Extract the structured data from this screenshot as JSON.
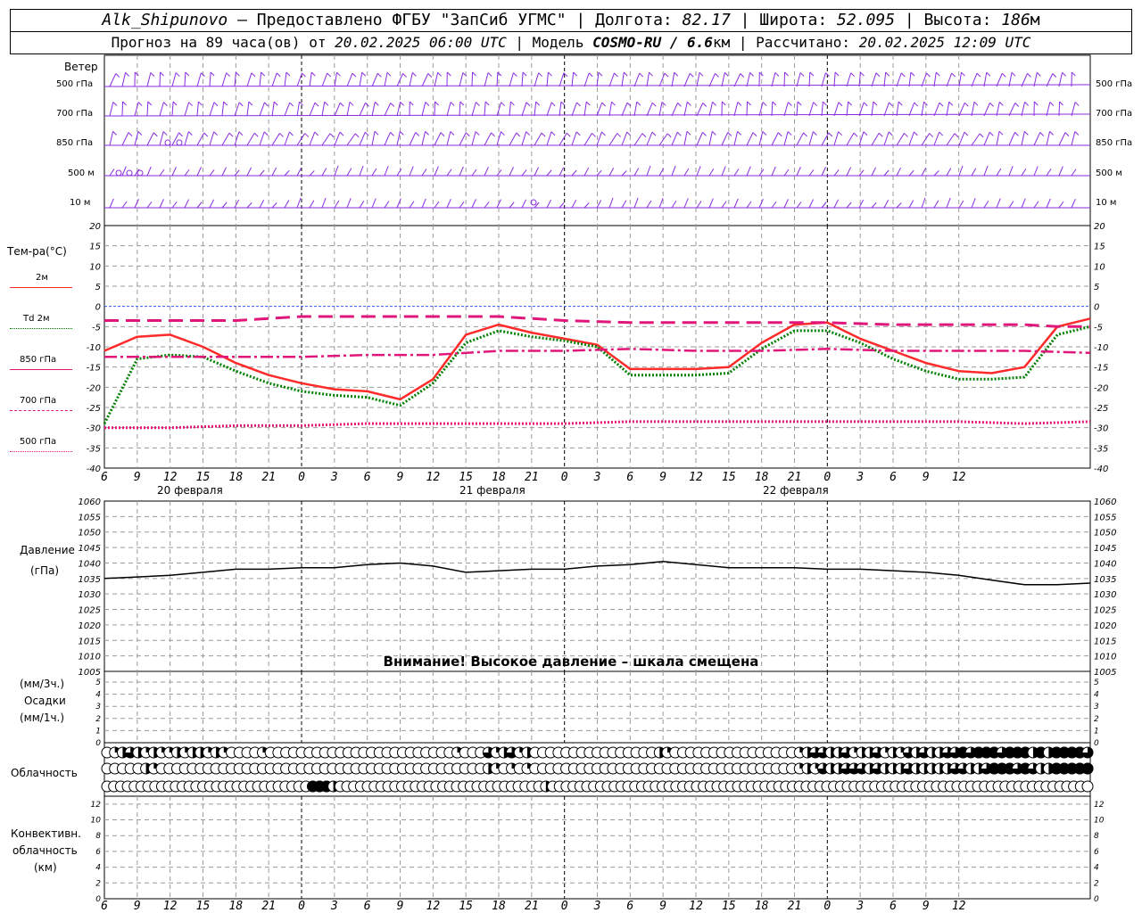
{
  "header": {
    "station": "Alk_Shipunovo",
    "provider_sep": " – Предоставлено ФГБУ \"ЗапСиб УГМС\" | ",
    "lon_label": "Долгота: ",
    "lon_value": "82.17",
    "lat_label": " | Широта: ",
    "lat_value": "52.095",
    "alt_label": " | Высота: ",
    "alt_value": "186",
    "alt_unit": "м",
    "forecast_prefix": "Прогноз на 89 часа(ов) от ",
    "forecast_date": "20.02.2025 06:00 UTC",
    "model_label": "  | Модель ",
    "model_name": "COSMO-RU / 6.6",
    "model_unit": "км",
    "calc_label": " | Рассчитано: ",
    "calc_date": "20.02.2025 12:09 UTC"
  },
  "wind_panel": {
    "title": "Ветер",
    "levels": [
      "500 гПа",
      "700 гПа",
      "850 гПа",
      "500 м",
      "10  м"
    ]
  },
  "temp_panel": {
    "title": "Тем-ра(°С)",
    "legend": [
      {
        "label": "2м",
        "color": "#ff2a2a",
        "style": "solid"
      },
      {
        "label": "Td  2м",
        "color": "#008000",
        "style": "dotted"
      },
      {
        "label": "850 гПа",
        "color": "#e0167a",
        "style": "dashdot"
      },
      {
        "label": "700 гПа",
        "color": "#e0167a",
        "style": "dashed"
      },
      {
        "label": "500 гПа",
        "color": "#e0167a",
        "style": "dotted"
      }
    ]
  },
  "time_axis": {
    "hours": [
      "6",
      "9",
      "12",
      "15",
      "18",
      "21",
      "0",
      "3",
      "6",
      "9",
      "12",
      "15",
      "18",
      "21",
      "0",
      "3",
      "6",
      "9",
      "12",
      "15",
      "18",
      "21",
      "0",
      "3",
      "6",
      "9",
      "12"
    ],
    "dates": [
      "20 февраля",
      "21 февраля",
      "22 февраля"
    ]
  },
  "pressure_panel": {
    "title": "Давление",
    "unit": "(гПа)",
    "warning": "Внимание! Высокое давление – шкала смещена"
  },
  "precip_panel": {
    "unit3": "(мм/3ч.)",
    "title": "Осадки",
    "unit1": "(мм/1ч.)"
  },
  "cloud_panel": {
    "title": "Облачность"
  },
  "conv_panel": {
    "title1": "Конвективн.",
    "title2": "облачность",
    "unit": "(км)"
  },
  "chart_data": [
    {
      "type": "line",
      "title": "Тем-ра(°С)",
      "x_unit": "hours since 20.02.2025 06:00 UTC",
      "ylim": [
        -40,
        20
      ],
      "yticks": [
        20,
        15,
        10,
        5,
        0,
        -5,
        -10,
        -15,
        -20,
        -25,
        -30,
        -35,
        -40
      ],
      "grid": true,
      "series": [
        {
          "name": "2м",
          "color": "#ff2a2a",
          "x": [
            0,
            3,
            6,
            9,
            12,
            15,
            18,
            21,
            24,
            27,
            30,
            33,
            36,
            39,
            42,
            45,
            48,
            51,
            54,
            57,
            60,
            63,
            66,
            69,
            72,
            75,
            78,
            81,
            84,
            87,
            90
          ],
          "y": [
            -11,
            -7.5,
            -7,
            -10,
            -14,
            -17,
            -19,
            -20.5,
            -21,
            -23,
            -18,
            -7,
            -4.5,
            -6.5,
            -8,
            -9.5,
            -15.5,
            -15.5,
            -15.5,
            -15,
            -9,
            -4.5,
            -4,
            -8,
            -11,
            -14,
            -16,
            -16.5,
            -15,
            -5,
            -3
          ]
        },
        {
          "name": "Td  2м",
          "color": "#008000",
          "x": [
            0,
            3,
            6,
            9,
            12,
            15,
            18,
            21,
            24,
            27,
            30,
            33,
            36,
            39,
            42,
            45,
            48,
            51,
            54,
            57,
            60,
            63,
            66,
            69,
            72,
            75,
            78,
            81,
            84,
            87,
            90
          ],
          "y": [
            -29,
            -13,
            -12,
            -12.5,
            -16,
            -19,
            -21,
            -22,
            -22.5,
            -24.5,
            -19,
            -9,
            -6,
            -7.5,
            -8.5,
            -10,
            -17,
            -17,
            -17,
            -16.5,
            -10.5,
            -6,
            -6,
            -9,
            -13,
            -16,
            -18,
            -18,
            -17.5,
            -7,
            -5
          ]
        },
        {
          "name": "850 гПа",
          "color": "#e0167a",
          "x": [
            0,
            6,
            12,
            18,
            24,
            30,
            36,
            42,
            48,
            54,
            60,
            66,
            72,
            78,
            84,
            90
          ],
          "y": [
            -12.5,
            -12.5,
            -12.5,
            -12.5,
            -12,
            -12,
            -11,
            -11,
            -10.5,
            -11,
            -11,
            -10.5,
            -11,
            -11,
            -11,
            -11.5
          ]
        },
        {
          "name": "700 гПа",
          "color": "#e0167a",
          "x": [
            0,
            6,
            12,
            18,
            24,
            30,
            36,
            42,
            48,
            54,
            60,
            66,
            72,
            78,
            84,
            87,
            90
          ],
          "y": [
            -3.5,
            -3.5,
            -3.5,
            -2.5,
            -2.5,
            -2.5,
            -2.5,
            -3.5,
            -4,
            -4,
            -4,
            -4,
            -4.5,
            -4.5,
            -4.5,
            -5,
            -5
          ]
        },
        {
          "name": "500 гПа",
          "color": "#e0167a",
          "x": [
            0,
            6,
            12,
            18,
            24,
            30,
            36,
            42,
            48,
            54,
            60,
            66,
            72,
            78,
            84,
            90
          ],
          "y": [
            -30,
            -30,
            -29.5,
            -29.5,
            -29,
            -29,
            -29,
            -29,
            -28.5,
            -28.5,
            -28.5,
            -28.5,
            -28.5,
            -28.5,
            -29,
            -28.5
          ]
        }
      ]
    },
    {
      "type": "line",
      "title": "Давление",
      "ylabel": "(гПа)",
      "ylim": [
        1005,
        1060
      ],
      "yticks": [
        1060,
        1055,
        1050,
        1045,
        1040,
        1035,
        1030,
        1025,
        1020,
        1015,
        1010,
        1005
      ],
      "grid": true,
      "series": [
        {
          "name": "",
          "color": "#000000",
          "x": [
            0,
            3,
            6,
            9,
            12,
            15,
            18,
            21,
            24,
            27,
            30,
            33,
            36,
            39,
            42,
            45,
            48,
            51,
            54,
            57,
            60,
            63,
            66,
            69,
            72,
            75,
            78,
            81,
            84,
            87,
            90
          ],
          "y": [
            1035,
            1035.5,
            1036,
            1037,
            1038,
            1038,
            1038.5,
            1038.5,
            1039.5,
            1040,
            1039,
            1037,
            1037.5,
            1038,
            1038,
            1039,
            1039.5,
            1040.5,
            1039.5,
            1038.5,
            1038.5,
            1038.5,
            1038,
            1038,
            1037.5,
            1037,
            1036,
            1034.5,
            1033,
            1033,
            1033.5
          ]
        }
      ]
    },
    {
      "type": "bar",
      "title": "Осадки",
      "ylim": [
        0,
        5
      ],
      "yticks": [
        5,
        4,
        3,
        2,
        1,
        0
      ],
      "series": [
        {
          "name": "",
          "values": []
        }
      ]
    },
    {
      "type": "table",
      "title": "Облачность",
      "note": "cloud fraction per time step (0..1), rows: upper, middle, lower",
      "rows": {
        "upper": [
          0,
          0.25,
          0.5,
          0.75,
          0.5,
          0.25,
          0.5,
          0.25,
          0.25,
          0.5,
          0.25,
          0.5,
          0.5,
          0.25,
          0.5,
          0.25,
          0,
          0,
          0,
          0,
          0.25,
          0,
          0,
          0,
          0,
          0,
          0,
          0,
          0,
          0,
          0,
          0,
          0,
          0,
          0,
          0,
          0,
          0,
          0,
          0,
          0,
          0,
          0,
          0,
          0,
          0.25,
          0,
          0,
          0,
          0.75,
          0.25,
          0.5,
          0.75,
          0.25,
          0.5,
          0,
          0,
          0,
          0,
          0,
          0,
          0,
          0,
          0,
          0,
          0,
          0,
          0,
          0,
          0,
          0,
          0.5,
          0.25,
          0,
          0,
          0,
          0,
          0,
          0,
          0,
          0,
          0,
          0,
          0,
          0,
          0,
          0,
          0,
          0,
          0.25,
          0.5,
          0.75,
          0.75,
          0.5,
          0.5,
          0.75,
          0.25,
          0.5,
          0.5,
          0.75,
          0.25,
          0.5,
          0.25,
          0.75,
          0.5,
          0.75,
          0.5,
          0.5,
          0.75,
          0.75,
          1,
          0.75,
          1,
          1,
          1,
          0.75,
          1,
          1,
          1,
          0.5,
          1,
          0.5,
          1,
          1,
          1,
          1,
          0.75
        ],
        "middle": [
          0,
          0,
          0,
          0,
          0,
          0.5,
          0.25,
          0,
          0,
          0,
          0,
          0,
          0,
          0,
          0,
          0,
          0,
          0,
          0,
          0,
          0,
          0,
          0,
          0,
          0,
          0,
          0,
          0,
          0,
          0,
          0,
          0,
          0,
          0,
          0,
          0,
          0,
          0,
          0,
          0,
          0,
          0,
          0,
          0,
          0,
          0,
          0,
          0,
          0,
          0.5,
          0.25,
          0,
          0.25,
          0,
          0.25,
          0,
          0,
          0,
          0,
          0,
          0,
          0,
          0,
          0,
          0,
          0,
          0,
          0,
          0,
          0,
          0,
          0,
          0,
          0,
          0,
          0,
          0,
          0,
          0,
          0,
          0,
          0,
          0,
          0,
          0,
          0,
          0,
          0,
          0,
          0.25,
          0.5,
          0.25,
          0.75,
          0.5,
          0.5,
          0.75,
          0.75,
          0.75,
          0.5,
          0.75,
          0.5,
          0.5,
          0.5,
          0.75,
          0.5,
          0.5,
          0.5,
          0.5,
          0.5,
          0.75,
          0.75,
          0.5,
          0.5,
          0.75,
          1,
          1,
          1,
          0.75,
          1,
          0.75,
          0.5,
          0.5,
          1,
          1,
          1,
          1,
          1
        ],
        "lower": [
          0,
          0,
          0,
          0,
          0,
          0,
          0,
          0,
          0,
          0,
          0,
          0,
          0,
          0,
          0,
          0,
          0,
          0,
          0,
          0,
          0,
          0,
          0,
          0,
          0,
          0,
          0,
          0,
          0,
          0,
          1,
          1,
          1,
          0.5,
          0,
          0,
          0,
          0,
          0,
          0,
          0,
          0,
          0,
          0,
          0,
          0,
          0,
          0,
          0,
          0,
          0,
          0,
          0,
          0,
          0,
          0,
          0,
          0,
          0,
          0,
          0,
          0,
          0,
          0,
          0.5,
          0,
          0,
          0,
          0,
          0,
          0,
          0,
          0,
          0,
          0,
          0,
          0,
          0,
          0,
          0,
          0,
          0,
          0,
          0,
          0,
          0,
          0,
          0,
          0,
          0,
          0,
          0,
          0,
          0,
          0,
          0,
          0,
          0,
          0,
          0,
          0,
          0,
          0,
          0,
          0,
          0,
          0,
          0,
          0,
          0,
          0,
          0,
          0,
          0,
          0,
          0,
          0,
          0,
          0,
          0,
          0,
          0,
          0,
          0,
          0,
          0,
          0,
          0,
          0,
          0,
          0,
          0,
          0,
          0,
          0,
          0,
          0,
          0,
          0,
          0,
          0,
          0,
          0,
          0
        ]
      }
    },
    {
      "type": "bar",
      "title": "Конвективн. облачность",
      "ylabel": "(км)",
      "ylim": [
        0,
        13
      ],
      "yticks": [
        12,
        10,
        8,
        6,
        4,
        2,
        0
      ],
      "series": [
        {
          "name": "",
          "values": []
        }
      ]
    }
  ]
}
